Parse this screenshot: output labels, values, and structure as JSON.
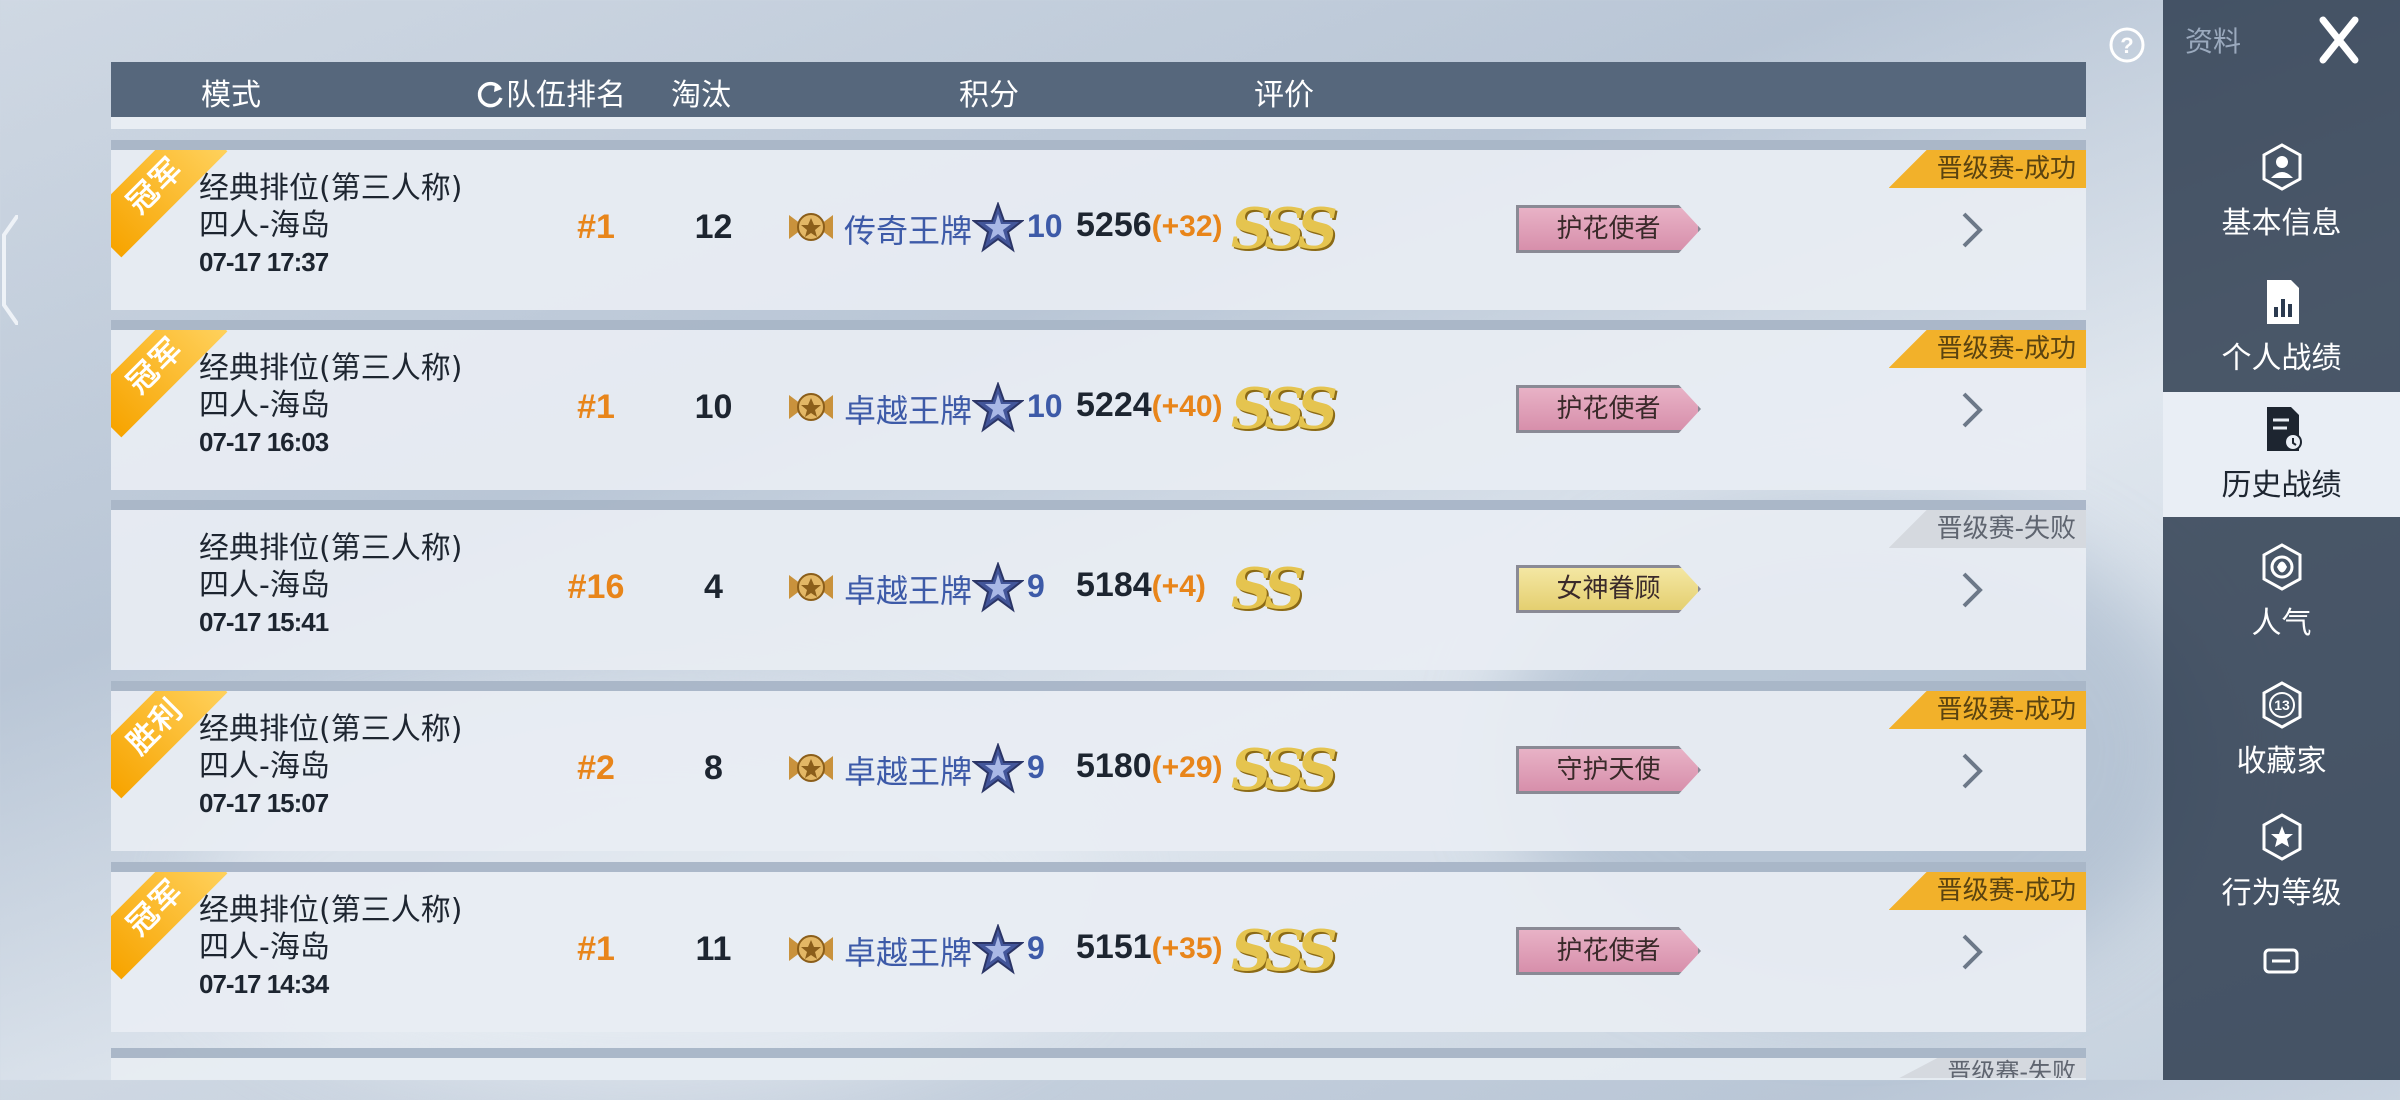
{
  "header": {
    "mode": "模式",
    "team_rank": "队伍排名",
    "kills": "淘汰",
    "score": "积分",
    "rating": "评价"
  },
  "rows": [
    {
      "ribbon": "冠军",
      "mode": "经典排位(第三人称)",
      "map": "四人-海岛",
      "date": "07-17 17:37",
      "rank": "#1",
      "kills": "12",
      "tier": "传奇王牌",
      "stars": "10",
      "score": "5256",
      "delta": "(+32)",
      "grade": "SSS",
      "title": "护花使者",
      "title_style": "pink",
      "status": "晋级赛-成功"
    },
    {
      "ribbon": "冠军",
      "mode": "经典排位(第三人称)",
      "map": "四人-海岛",
      "date": "07-17 16:03",
      "rank": "#1",
      "kills": "10",
      "tier": "卓越王牌",
      "stars": "10",
      "score": "5224",
      "delta": "(+40)",
      "grade": "SSS",
      "title": "护花使者",
      "title_style": "pink",
      "status": "晋级赛-成功"
    },
    {
      "ribbon": "",
      "mode": "经典排位(第三人称)",
      "map": "四人-海岛",
      "date": "07-17 15:41",
      "rank": "#16",
      "kills": "4",
      "tier": "卓越王牌",
      "stars": "9",
      "score": "5184",
      "delta": "(+4)",
      "grade": "SS",
      "title": "女神眷顾",
      "title_style": "gold",
      "status": "晋级赛-失败"
    },
    {
      "ribbon": "胜利",
      "mode": "经典排位(第三人称)",
      "map": "四人-海岛",
      "date": "07-17 15:07",
      "rank": "#2",
      "kills": "8",
      "tier": "卓越王牌",
      "stars": "9",
      "score": "5180",
      "delta": "(+29)",
      "grade": "SSS",
      "title": "守护天使",
      "title_style": "pink",
      "status": "晋级赛-成功"
    },
    {
      "ribbon": "冠军",
      "mode": "经典排位(第三人称)",
      "map": "四人-海岛",
      "date": "07-17 14:34",
      "rank": "#1",
      "kills": "11",
      "tier": "卓越王牌",
      "stars": "9",
      "score": "5151",
      "delta": "(+35)",
      "grade": "SSS",
      "title": "护花使者",
      "title_style": "pink",
      "status": "晋级赛-成功"
    }
  ],
  "peek_status": "晋级赛-失败",
  "sidebar": {
    "top_label": "资料",
    "items": [
      {
        "label": "基本信息",
        "icon": "profile-icon"
      },
      {
        "label": "个人战绩",
        "icon": "stats-icon"
      },
      {
        "label": "历史战绩",
        "icon": "history-icon",
        "active": true
      },
      {
        "label": "人气",
        "icon": "popularity-icon"
      },
      {
        "label": "收藏家",
        "icon": "collector-icon",
        "badge": "13"
      },
      {
        "label": "行为等级",
        "icon": "behavior-icon"
      }
    ]
  },
  "colors": {
    "accent": "#e8851a",
    "tier_blue": "#3d5aa8",
    "status_win": "#f2b12a",
    "header_bg": "#56677c"
  }
}
